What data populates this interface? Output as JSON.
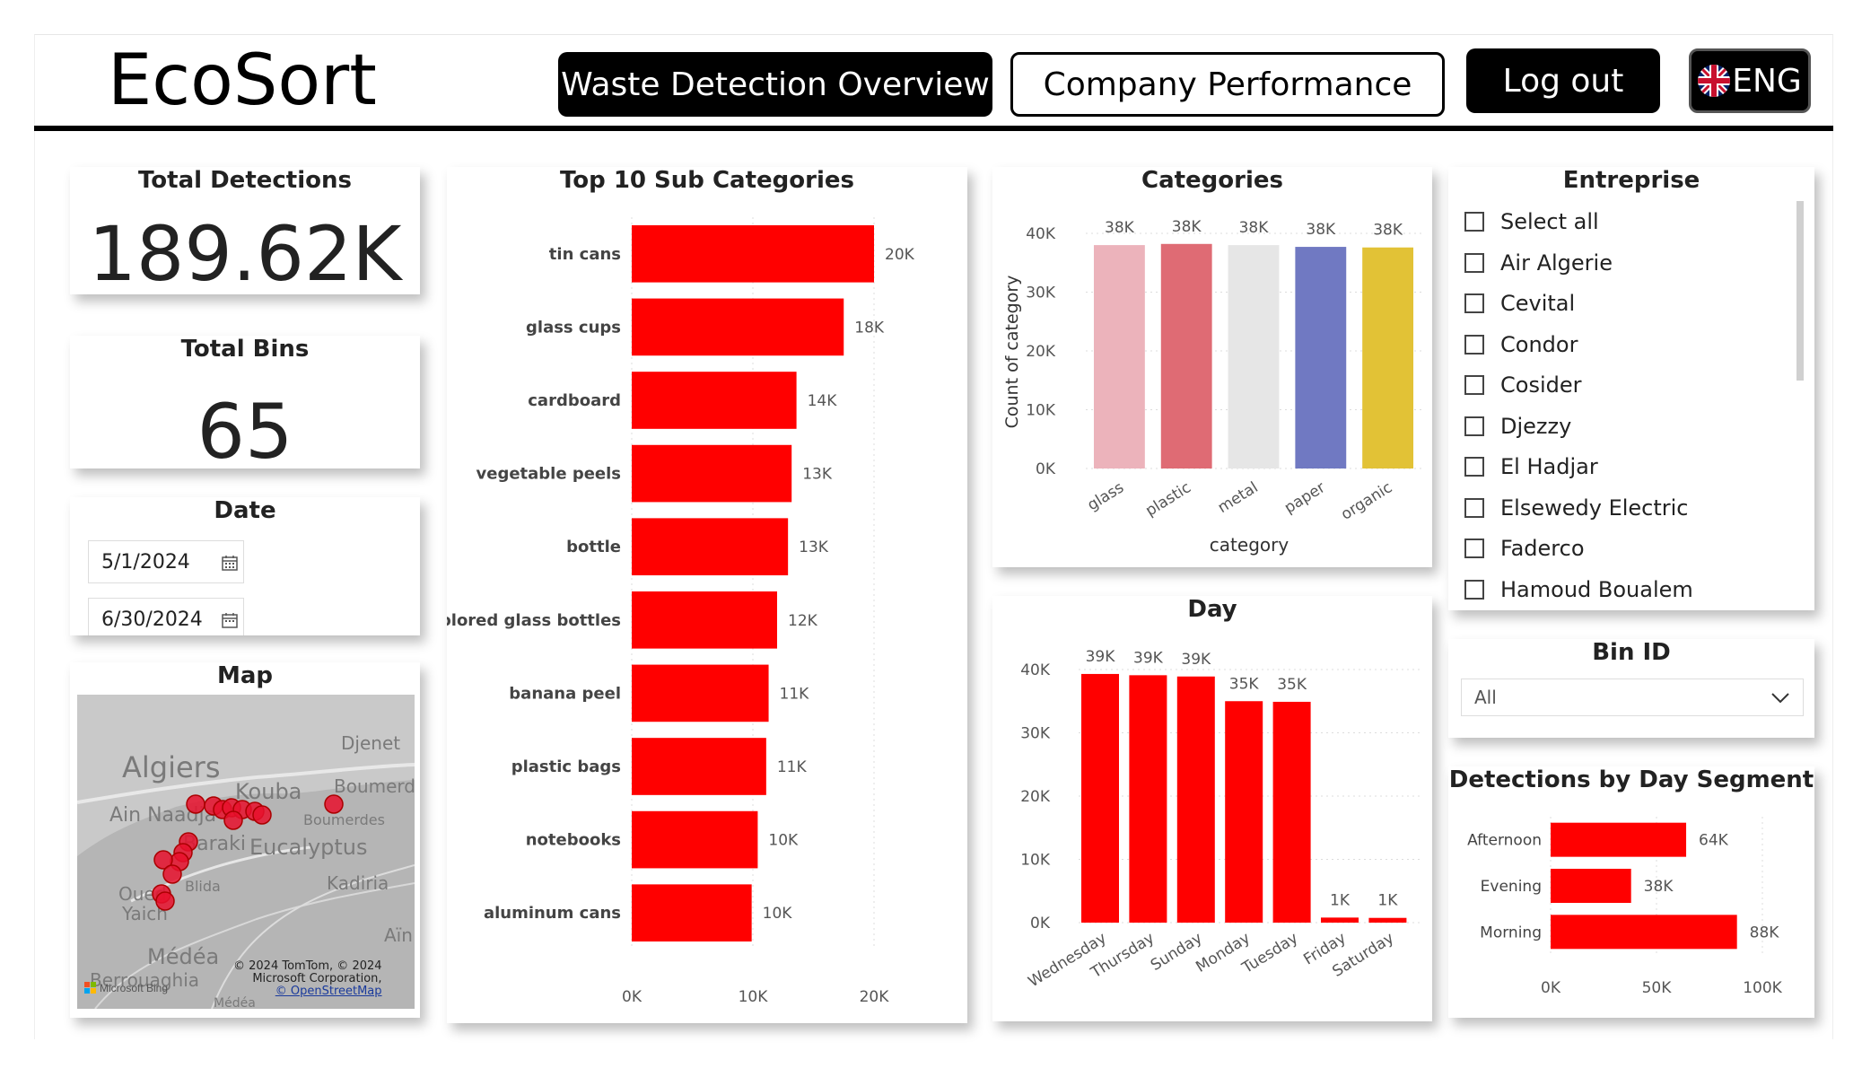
{
  "app": {
    "title": "EcoSort"
  },
  "nav": {
    "waste_detection": "Waste Detection Overview",
    "company_performance": "Company Performance",
    "logout": "Log out",
    "language": "ENG"
  },
  "kpis": {
    "total_detections": {
      "label": "Total Detections",
      "value": "189.62K"
    },
    "total_bins": {
      "label": "Total Bins",
      "value": "65"
    }
  },
  "date": {
    "label": "Date",
    "start": "5/1/2024",
    "end": "6/30/2024"
  },
  "map": {
    "label": "Map",
    "places": [
      "Algiers",
      "Djenet",
      "Kouba",
      "Boumerdè",
      "Ain Naadja",
      "Boumerdes",
      "Baraki",
      "Eucalyptus",
      "Blida",
      "Kadiria",
      "Oued",
      "Yaich",
      "Aïn",
      "Médéa",
      "Berrouaghia",
      "Médéa"
    ],
    "attribution_line1": "© 2024 TomTom, © 2024",
    "attribution_line2": "Microsoft Corporation,",
    "attribution_link": "© OpenStreetMap",
    "bing": "Microsoft Bing"
  },
  "enterprise": {
    "label": "Entreprise",
    "items": [
      "Select all",
      "Air Algerie",
      "Cevital",
      "Condor",
      "Cosider",
      "Djezzy",
      "El Hadjar",
      "Elsewedy Electric",
      "Faderco",
      "Hamoud Boualem"
    ]
  },
  "bin_id": {
    "label": "Bin ID",
    "selected": "All"
  },
  "charts": {
    "top_sub": {
      "title": "Top 10 Sub Categories",
      "x_ticks": [
        "0K",
        "10K",
        "20K"
      ]
    },
    "categories": {
      "title": "Categories",
      "xlabel": "category",
      "ylabel": "Count of category",
      "y_ticks": [
        "0K",
        "10K",
        "20K",
        "30K",
        "40K"
      ]
    },
    "day": {
      "title": "Day",
      "y_ticks": [
        "0K",
        "10K",
        "20K",
        "30K",
        "40K"
      ]
    },
    "segment": {
      "title": "Detections by Day Segment",
      "x_ticks": [
        "0K",
        "50K",
        "100K"
      ]
    }
  },
  "chart_data": [
    {
      "type": "bar",
      "orientation": "horizontal",
      "title": "Top 10 Sub Categories",
      "categories": [
        "tin cans",
        "glass cups",
        "cardboard",
        "vegetable peels",
        "bottle",
        "colored glass bottles",
        "banana peel",
        "plastic bags",
        "notebooks",
        "aluminum cans"
      ],
      "values": [
        20000,
        17500,
        13600,
        13200,
        12900,
        12000,
        11300,
        11100,
        10400,
        9900
      ],
      "labels": [
        "20K",
        "18K",
        "14K",
        "13K",
        "13K",
        "12K",
        "11K",
        "11K",
        "10K",
        "10K"
      ],
      "xlim": [
        0,
        20000
      ],
      "color": "#ff0000",
      "grid": true
    },
    {
      "type": "bar",
      "title": "Categories",
      "xlabel": "category",
      "ylabel": "Count of category",
      "categories": [
        "glass",
        "plastic",
        "metal",
        "paper",
        "organic"
      ],
      "values": [
        38000,
        38200,
        38000,
        37700,
        37600
      ],
      "labels": [
        "38K",
        "38K",
        "38K",
        "38K",
        "38K"
      ],
      "colors": [
        "#ecb3bb",
        "#df6b74",
        "#e6e6e6",
        "#7079c2",
        "#e2c236"
      ],
      "ylim": [
        0,
        40000
      ],
      "grid": true
    },
    {
      "type": "bar",
      "title": "Day",
      "categories": [
        "Wednesday",
        "Thursday",
        "Sunday",
        "Monday",
        "Tuesday",
        "Friday",
        "Saturday"
      ],
      "values": [
        39300,
        39100,
        38900,
        35000,
        34900,
        800,
        750
      ],
      "labels": [
        "39K",
        "39K",
        "39K",
        "35K",
        "35K",
        "1K",
        "1K"
      ],
      "ylim": [
        0,
        40000
      ],
      "color": "#ff0000",
      "grid": true
    },
    {
      "type": "bar",
      "orientation": "horizontal",
      "title": "Detections by Day Segment",
      "categories": [
        "Afternoon",
        "Evening",
        "Morning"
      ],
      "values": [
        64000,
        38000,
        88000
      ],
      "labels": [
        "64K",
        "38K",
        "88K"
      ],
      "xlim": [
        0,
        100000
      ],
      "color": "#ff0000",
      "grid": true
    }
  ],
  "colors": {
    "accent": "#ff0000",
    "dark": "#000000"
  }
}
